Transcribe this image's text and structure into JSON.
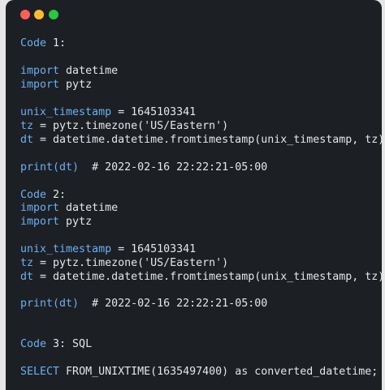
{
  "window": {
    "controls": [
      "close",
      "minimize",
      "maximize"
    ]
  },
  "code_lines": [
    {
      "name": "code-1-heading",
      "segments": [
        [
          "kw",
          "Code"
        ],
        [
          "txt",
          " 1:"
        ]
      ]
    },
    {
      "name": "import-datetime-1",
      "segments": [
        [
          "kw",
          "import"
        ],
        [
          "txt",
          " datetime"
        ]
      ]
    },
    {
      "name": "import-pytz-1",
      "segments": [
        [
          "kw",
          "import"
        ],
        [
          "txt",
          " pytz"
        ]
      ]
    },
    {
      "name": "unix-timestamp-1",
      "segments": [
        [
          "kw",
          "unix_timestamp"
        ],
        [
          "txt",
          " = 1645103341"
        ]
      ]
    },
    {
      "name": "tz-1",
      "segments": [
        [
          "kw",
          "tz"
        ],
        [
          "txt",
          " = pytz.timezone('US/Eastern')"
        ]
      ]
    },
    {
      "name": "dt-1",
      "segments": [
        [
          "kw",
          "dt"
        ],
        [
          "txt",
          " = datetime.datetime.fromtimestamp(unix_timestamp, tz)"
        ]
      ]
    },
    {
      "name": "print-dt-1",
      "segments": [
        [
          "kw",
          "print(dt)"
        ],
        [
          "txt",
          "  # 2022-02-16 22:22:21-05:00"
        ]
      ]
    },
    {
      "name": "code-2-heading",
      "segments": [
        [
          "kw",
          "Code"
        ],
        [
          "txt",
          " 2:"
        ]
      ]
    },
    {
      "name": "import-datetime-2",
      "segments": [
        [
          "kw",
          "import"
        ],
        [
          "txt",
          " datetime"
        ]
      ]
    },
    {
      "name": "import-pytz-2",
      "segments": [
        [
          "kw",
          "import"
        ],
        [
          "txt",
          " pytz"
        ]
      ]
    },
    {
      "name": "unix-timestamp-2",
      "segments": [
        [
          "kw",
          "unix_timestamp"
        ],
        [
          "txt",
          " = 1645103341"
        ]
      ]
    },
    {
      "name": "tz-2",
      "segments": [
        [
          "kw",
          "tz"
        ],
        [
          "txt",
          " = pytz.timezone('US/Eastern')"
        ]
      ]
    },
    {
      "name": "dt-2",
      "segments": [
        [
          "kw",
          "dt"
        ],
        [
          "txt",
          " = datetime.datetime.fromtimestamp(unix_timestamp, tz)"
        ]
      ]
    },
    {
      "name": "print-dt-2",
      "segments": [
        [
          "kw",
          "print(dt)"
        ],
        [
          "txt",
          "  # 2022-02-16 22:22:21-05:00"
        ]
      ]
    },
    {
      "name": "code-3-heading",
      "segments": [
        [
          "kw",
          "Code"
        ],
        [
          "txt",
          " 3: SQL"
        ]
      ]
    },
    {
      "name": "sql-select",
      "segments": [
        [
          "kw",
          "SELECT"
        ],
        [
          "txt",
          " FROM_UNIXTIME(1635497400) as converted_datetime;"
        ]
      ]
    }
  ],
  "colors": {
    "background": "#1c1f24",
    "keyword": "#6ab0f3",
    "text": "#e6e6e6"
  }
}
